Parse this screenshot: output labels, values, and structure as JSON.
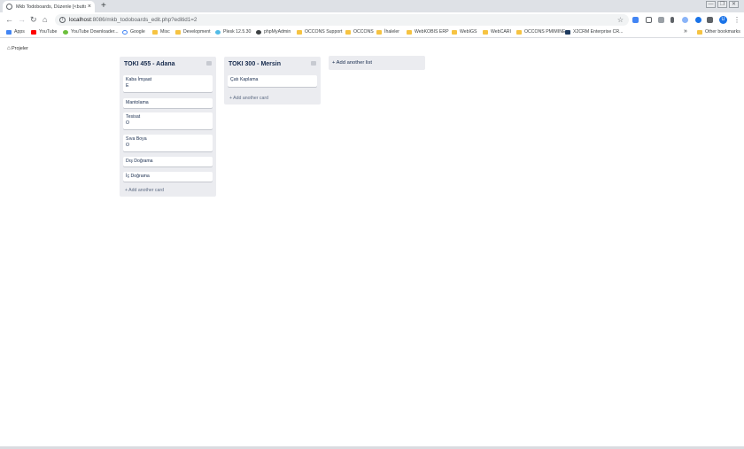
{
  "browser": {
    "tab_title": "Mkb Todoboards, Düzenle [<button>",
    "tab_close": "×",
    "new_tab": "+",
    "window_controls": [
      "—",
      "❐",
      "✕"
    ],
    "url_host": "localhost",
    "url_rest": ":8086/mkb_todoboards_edit.php?editid1=2",
    "nav": {
      "back": "←",
      "forward": "→",
      "reload": "↻",
      "home": "⌂"
    },
    "bookmarks": [
      {
        "label": "Apps",
        "icon": "apps-grid-icon"
      },
      {
        "label": "YouTube",
        "icon": "youtube-icon"
      },
      {
        "label": "YouTube Downloader...",
        "icon": "downloader-icon"
      },
      {
        "label": "Google",
        "icon": "google-icon"
      },
      {
        "label": "Misc",
        "icon": "folder-icon"
      },
      {
        "label": "Development",
        "icon": "folder-icon"
      },
      {
        "label": "Plesk 12.5.30",
        "icon": "plesk-icon"
      },
      {
        "label": "phpMyAdmin",
        "icon": "phpmyadmin-icon"
      },
      {
        "label": "OCCONS Support",
        "icon": "folder-icon"
      },
      {
        "label": "OCCONS",
        "icon": "folder-icon"
      },
      {
        "label": "İhaleler",
        "icon": "folder-icon"
      },
      {
        "label": "WebKOBIS ERP",
        "icon": "folder-icon"
      },
      {
        "label": "WebIGS",
        "icon": "folder-icon"
      },
      {
        "label": "WebCARI",
        "icon": "folder-icon"
      },
      {
        "label": "OCCONS PMIMINE",
        "icon": "folder-icon"
      },
      {
        "label": "X2CRM Enterprise CR...",
        "icon": "x2crm-icon"
      }
    ],
    "more_bookmarks": "»",
    "other_bookmarks": "Other bookmarks",
    "profile_initial": "U",
    "menu": "⋮"
  },
  "page": {
    "breadcrumb": "Projeler",
    "lists": [
      {
        "title": "TOKI 455 - Adana",
        "cards": [
          {
            "title": "Kaba İmşaat",
            "sub": "E"
          },
          {
            "title": "Mantolama",
            "sub": ""
          },
          {
            "title": "Tesisat",
            "sub": "O"
          },
          {
            "title": "Sıva Boya",
            "sub": "O"
          },
          {
            "title": "Dış Doğrama",
            "sub": ""
          },
          {
            "title": "İç Doğrama",
            "sub": ""
          }
        ],
        "add_card": "+ Add another card"
      },
      {
        "title": "TOKI 300 - Mersin",
        "cards": [
          {
            "title": "Çatı Kaplama",
            "sub": ""
          }
        ],
        "add_card": "+ Add another card"
      }
    ],
    "add_list": "+ Add another list"
  }
}
